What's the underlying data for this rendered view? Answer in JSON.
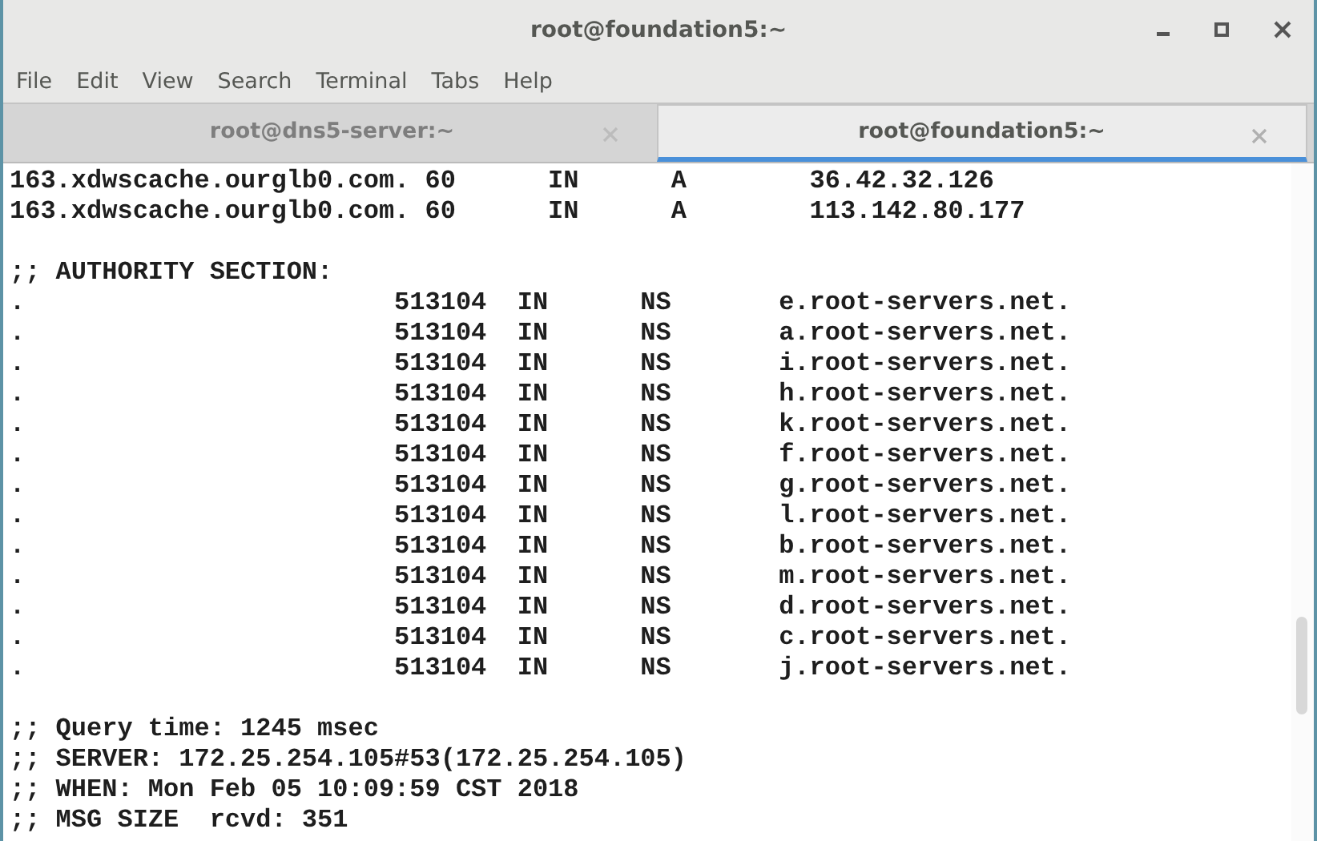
{
  "window": {
    "title": "root@foundation5:~"
  },
  "menu": [
    "File",
    "Edit",
    "View",
    "Search",
    "Terminal",
    "Tabs",
    "Help"
  ],
  "tabs": [
    {
      "label": "root@dns5-server:~",
      "selected": false
    },
    {
      "label": "root@foundation5:~",
      "selected": true
    }
  ],
  "terminal": {
    "blocks": [
      [
        "163.xdwscache.ourglb0.com. 60      IN      A        36.42.32.126",
        "163.xdwscache.ourglb0.com. 60      IN      A        113.142.80.177"
      ],
      [
        ";; AUTHORITY SECTION:",
        ".                        513104  IN      NS       e.root-servers.net.",
        ".                        513104  IN      NS       a.root-servers.net.",
        ".                        513104  IN      NS       i.root-servers.net.",
        ".                        513104  IN      NS       h.root-servers.net.",
        ".                        513104  IN      NS       k.root-servers.net.",
        ".                        513104  IN      NS       f.root-servers.net.",
        ".                        513104  IN      NS       g.root-servers.net.",
        ".                        513104  IN      NS       l.root-servers.net.",
        ".                        513104  IN      NS       b.root-servers.net.",
        ".                        513104  IN      NS       m.root-servers.net.",
        ".                        513104  IN      NS       d.root-servers.net.",
        ".                        513104  IN      NS       c.root-servers.net.",
        ".                        513104  IN      NS       j.root-servers.net."
      ],
      [
        ";; Query time: 1245 msec",
        ";; SERVER: 172.25.254.105#53(172.25.254.105)",
        ";; WHEN: Mon Feb 05 10:09:59 CST 2018",
        ";; MSG SIZE  rcvd: 351"
      ]
    ]
  }
}
